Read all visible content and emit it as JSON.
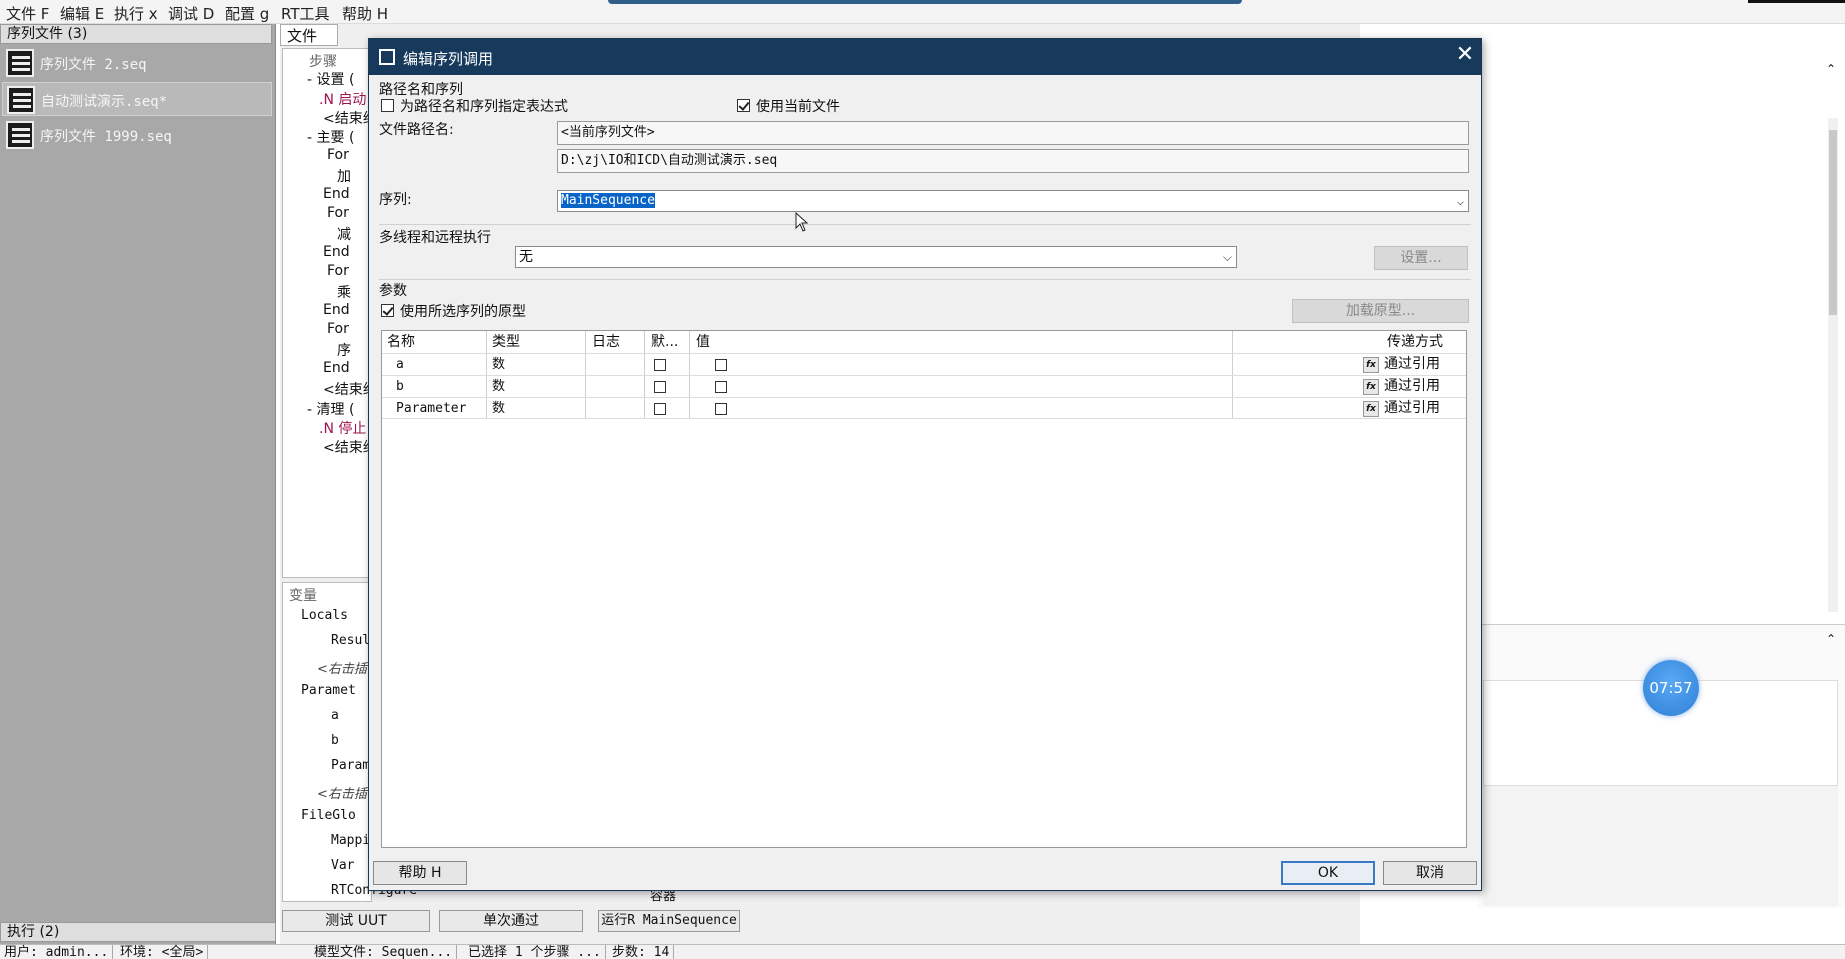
{
  "menu": [
    "文件 F",
    "编辑 E",
    "执行 x",
    "调试 D",
    "配置 g",
    "RT工具",
    "帮助 H"
  ],
  "left_panel": {
    "header": "序列文件 (3)",
    "files": [
      "序列文件 2.seq",
      "自动测试演示.seq*",
      "序列文件 1999.seq"
    ],
    "exec_header": "执行 (2)"
  },
  "middle": {
    "tab": "文件",
    "steps_header": "步骤",
    "steps": [
      "- 设置 (",
      ".N 启动",
      "<结束组",
      "- 主要 (",
      "For",
      "加",
      "End",
      "For",
      "减",
      "End",
      "For",
      "乘",
      "End",
      "For",
      "序",
      "End",
      "<结束组",
      "- 清理 (",
      ".N 停止",
      "<结束组"
    ],
    "vars_header": "变量",
    "vars": [
      "Locals",
      "Resul",
      "<右击插",
      "Paramet",
      "a",
      "b",
      "Param",
      "<右击插",
      "FileGlo",
      "Mappi",
      "Var",
      "RTConfigure"
    ],
    "bottom_buttons": [
      "测试 UUT",
      "单次通过",
      "运行R MainSequence"
    ],
    "hidden_combo": "容器"
  },
  "timer": "07:57",
  "statusbar": [
    "用户: admin...",
    "环境: <全局>",
    "模型文件: Sequen...",
    "已选择 1 个步骤 ...",
    "步数: 14"
  ],
  "dialog": {
    "title": "编辑序列调用",
    "close": "✕",
    "group_path": "路径名和序列",
    "chk_expression": "为路径名和序列指定表达式",
    "chk_use_current": "使用当前文件",
    "file_path_label": "文件路径名:",
    "file_path_value": "<当前序列文件>",
    "file_path_resolved": "D:\\zj\\IO和ICD\\自动测试演示.seq",
    "sequence_label": "序列:",
    "sequence_value": "MainSequence",
    "group_multithread": "多线程和远程执行",
    "multithread_value": "无",
    "settings_button": "设置...",
    "group_params": "参数",
    "chk_use_prototype": "使用所选序列的原型",
    "load_prototype_button": "加载原型...",
    "columns": [
      "名称",
      "类型",
      "日志",
      "默...",
      "值",
      "传递方式"
    ],
    "params": [
      {
        "name": "a",
        "type": "数",
        "value": "",
        "pass": "通过引用"
      },
      {
        "name": "b",
        "type": "数",
        "value": "",
        "pass": "通过引用"
      },
      {
        "name": "Parameter",
        "type": "数",
        "value": "",
        "pass": "通过引用"
      }
    ],
    "fx_label": "fx",
    "help_button": "帮助 H",
    "ok_button": "OK",
    "cancel_button": "取消"
  }
}
